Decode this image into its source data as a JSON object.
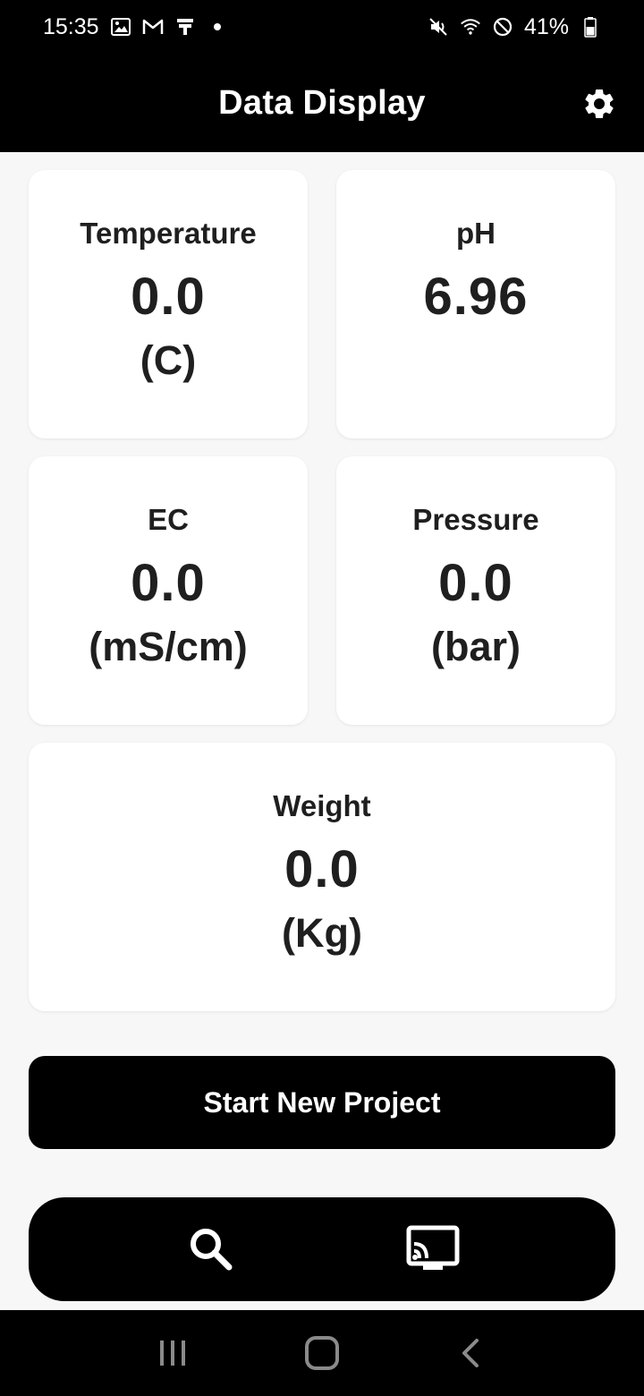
{
  "status_bar": {
    "time": "15:35",
    "battery": "41%",
    "icons_left": [
      "gallery-icon",
      "gmail-icon",
      "app-icon",
      "dot-icon"
    ],
    "icons_right": [
      "mute-icon",
      "wifi-icon",
      "do-not-disturb-icon",
      "battery-icon"
    ]
  },
  "header": {
    "title": "Data Display",
    "settings_icon": "gear-icon"
  },
  "cards": {
    "temperature": {
      "label": "Temperature",
      "value": "0.0",
      "unit": "(C)"
    },
    "ph": {
      "label": "pH",
      "value": "6.96"
    },
    "ec": {
      "label": "EC",
      "value": "0.0",
      "unit": "(mS/cm)"
    },
    "pressure": {
      "label": "Pressure",
      "value": "0.0",
      "unit": "(bar)"
    },
    "weight": {
      "label": "Weight",
      "value": "0.0",
      "unit": "(Kg)"
    }
  },
  "actions": {
    "start_label": "Start New Project"
  },
  "bottom_bar": {
    "left_icon": "search-icon",
    "right_icon": "cast-icon"
  },
  "nav": {
    "recents_icon": "recents-icon",
    "home_icon": "home-icon",
    "back_icon": "back-icon"
  },
  "colors": {
    "bar_background": "#000000",
    "page_background": "#f7f7f7",
    "card_background": "#ffffff",
    "text_primary": "#1f1f1f"
  }
}
